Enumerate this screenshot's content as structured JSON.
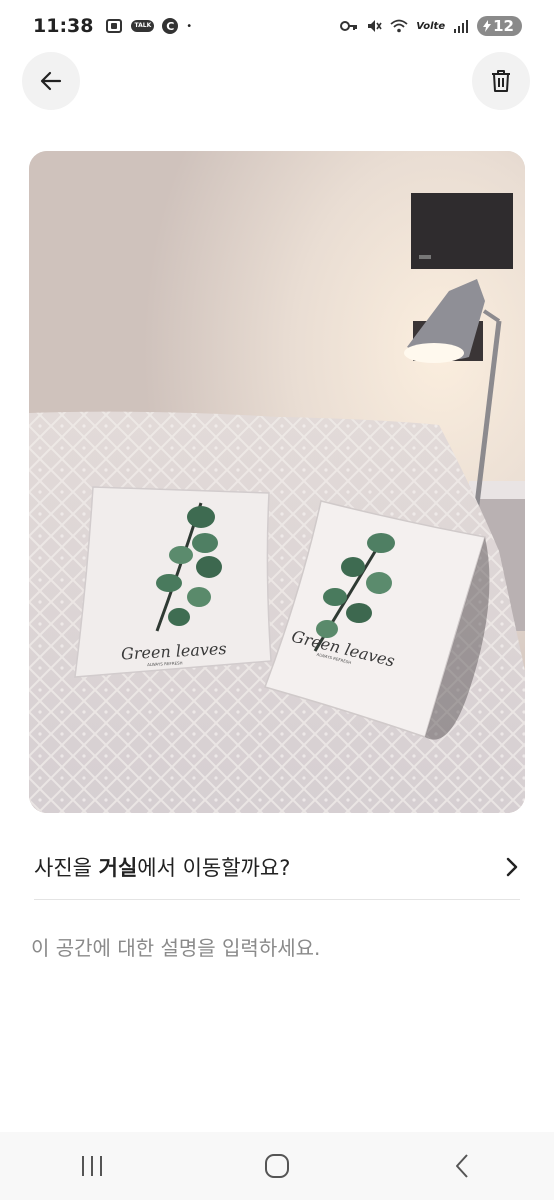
{
  "status_bar": {
    "time": "11:38",
    "talk_label": "TALK",
    "c_label": "C",
    "dot": "•",
    "network_label": "Volte",
    "battery_level": "12"
  },
  "photo": {
    "pillow_text_1": "Green leaves",
    "pillow_text_2": "Green leaves",
    "pillow_subtext": "ALWAYS REFRESH"
  },
  "move_prompt": {
    "prefix": "사진을 ",
    "room": "거실",
    "suffix": "에서 이동할까요?"
  },
  "description": {
    "placeholder": "이 공간에 대한 설명을 입력하세요.",
    "value": ""
  },
  "icons": {
    "back": "arrow-left-icon",
    "trash": "trash-icon",
    "chevron": "chevron-right-icon",
    "recents": "recents-icon",
    "home": "home-icon",
    "nav_back": "nav-back-icon"
  }
}
